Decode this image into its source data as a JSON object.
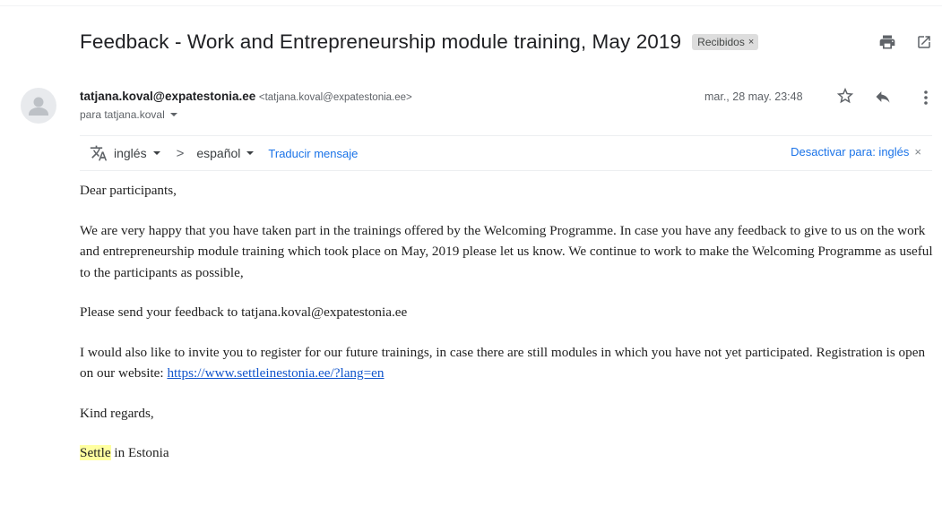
{
  "subject": {
    "title": "Feedback - Work and Entrepreneurship module training, May 2019",
    "label": "Recibidos",
    "label_close": "×"
  },
  "sender": {
    "name": "tatjana.koval@expatestonia.ee",
    "email": "<tatjana.koval@expatestonia.ee>",
    "to": "para tatjana.koval",
    "date": "mar., 28 may. 23:48"
  },
  "translate": {
    "from_lang": "inglés",
    "separator": ">",
    "to_lang": "español",
    "translate_link": "Traducir mensaje",
    "deactivate": "Desactivar para: inglés",
    "deactivate_close": "×"
  },
  "body": {
    "greeting": "Dear participants,",
    "p1": "We are very happy that you have taken part in the trainings offered by the Welcoming Programme. In case you have any feedback to give to us on the work and entrepreneurship module training which took place on May, 2019 please let us know. We continue to work to make the Welcoming Programme as useful to the participants as possible,",
    "p2": "Please send your feedback to  tatjana.koval@expatestonia.ee",
    "p3_text": "I would also like to invite you to register for our future trainings, in case there are still modules in which you have not yet participated. Registration is open on our website: ",
    "p3_link": "https://www.settleinestonia.ee/?lang=en",
    "regards": "Kind regards,",
    "sign_highlight": "Settle",
    "sign_rest": " in Estonia"
  },
  "icons": {
    "print": "print-icon",
    "open_new_window": "open-in-new-window-icon",
    "star": "star-icon",
    "reply": "reply-icon",
    "more": "more-vert-icon",
    "translate": "translate-icon",
    "avatar": "person-avatar-icon"
  },
  "colors": {
    "link": "#1a73e8",
    "body_link": "#1155cc",
    "highlight": "#ffffa0",
    "label_bg": "#dddddd"
  }
}
